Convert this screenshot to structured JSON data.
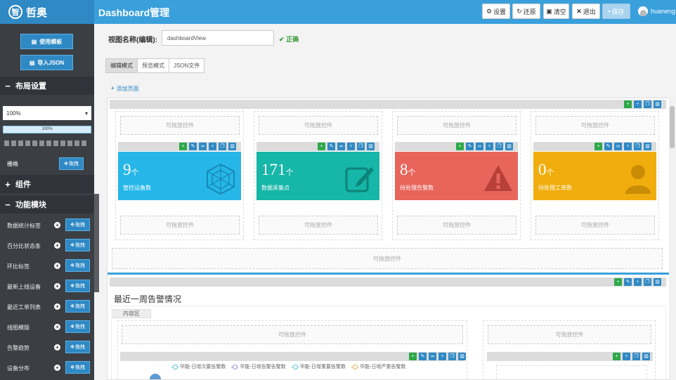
{
  "app": {
    "logo_mark": "智",
    "logo_text": "哲奥",
    "title": "Dashboard管理"
  },
  "toolbar": {
    "settings": "设置",
    "restore": "还原",
    "clear": "清空",
    "exit": "退出",
    "save": "保存"
  },
  "user": {
    "name": "huaneng"
  },
  "sidebar": {
    "use_template": "使用模板",
    "import_json": "导入JSON",
    "layout_title": "布局设置",
    "zoom": "100%",
    "zoom_bar": "100%",
    "grid_label": "栅格",
    "drag": "拖拽",
    "components_title": "组件",
    "modules_title": "功能模块",
    "modules": [
      "数据统计标签",
      "百分比状态条",
      "环比标签",
      "最新上线设备",
      "最近工单列表",
      "线图模版",
      "告警趋势",
      "设备分布"
    ]
  },
  "main": {
    "view_name_label": "视图名称(编辑):",
    "view_name_value": "dashboardView",
    "valid": "正确",
    "tabs": [
      "编辑模式",
      "预览模式",
      "JSON文件"
    ],
    "add_page": "添加页面",
    "drop_text": "可拖放控件",
    "cards": [
      {
        "value": "9",
        "unit": "个",
        "label": "管控设备数",
        "color": "#26b7e8",
        "icon": "hexagon-icon"
      },
      {
        "value": "171",
        "unit": "个",
        "label": "数据采集点",
        "color": "#16b6a8",
        "icon": "edit-icon"
      },
      {
        "value": "8",
        "unit": "个",
        "label": "待处理告警数",
        "color": "#e8655c",
        "icon": "warning-icon"
      },
      {
        "value": "0",
        "unit": "个",
        "label": "待处理工单数",
        "color": "#f0ad0d",
        "icon": "user-icon"
      }
    ],
    "section_title": "最近一周告警情况",
    "content_tag": "内容区",
    "legend": [
      {
        "name": "华能-日增次要告警数",
        "color": "#5bc0de"
      },
      {
        "name": "华能-日增告警告警数",
        "color": "#a78bda"
      },
      {
        "name": "华能-日增重要告警数",
        "color": "#5bc0de"
      },
      {
        "name": "华能-日增严重告警数",
        "color": "#f0ad4e"
      }
    ]
  }
}
